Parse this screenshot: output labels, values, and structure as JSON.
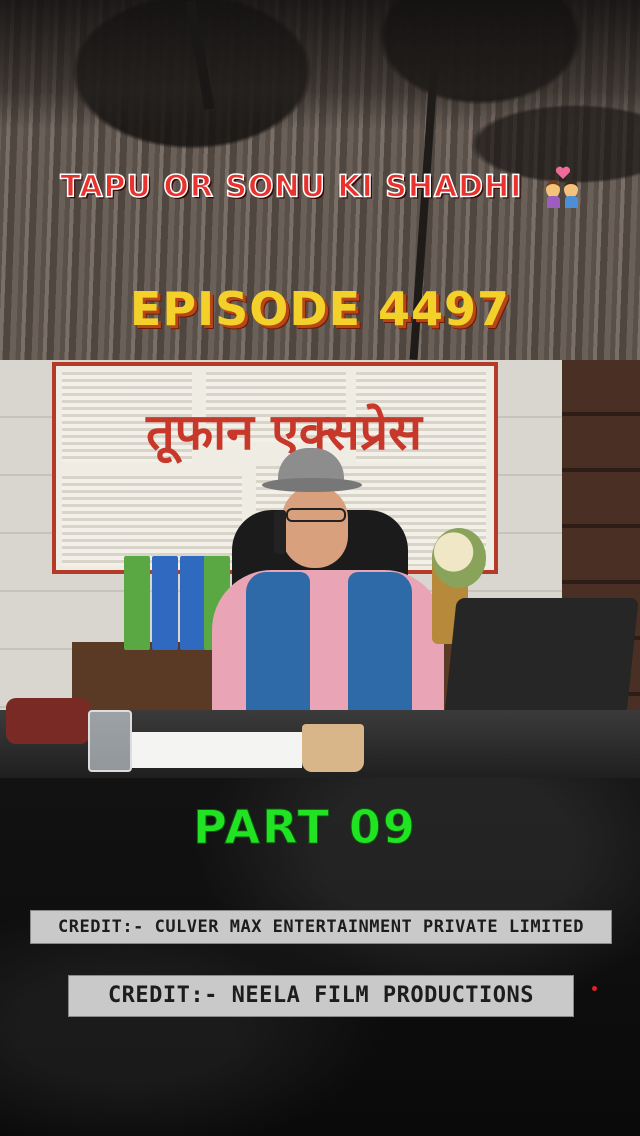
{
  "header": {
    "title": "TAPU OR SONU KI SHADHI",
    "title_emoji": "couple-with-heart-icon",
    "episode": "EPISODE 4497"
  },
  "video": {
    "board_text": "तूफान एक्सप्रेस"
  },
  "footer": {
    "part": "PART 09",
    "credit_1": "CREDIT:- CULVER MAX ENTERTAINMENT PRIVATE LIMITED",
    "credit_2": "CREDIT:- NEELA FILM PRODUCTIONS"
  },
  "colors": {
    "title_red": "#e8322e",
    "episode_yellow": "#f4d12a",
    "part_green": "#22e224",
    "credit_bg": "#c9c9c9"
  }
}
